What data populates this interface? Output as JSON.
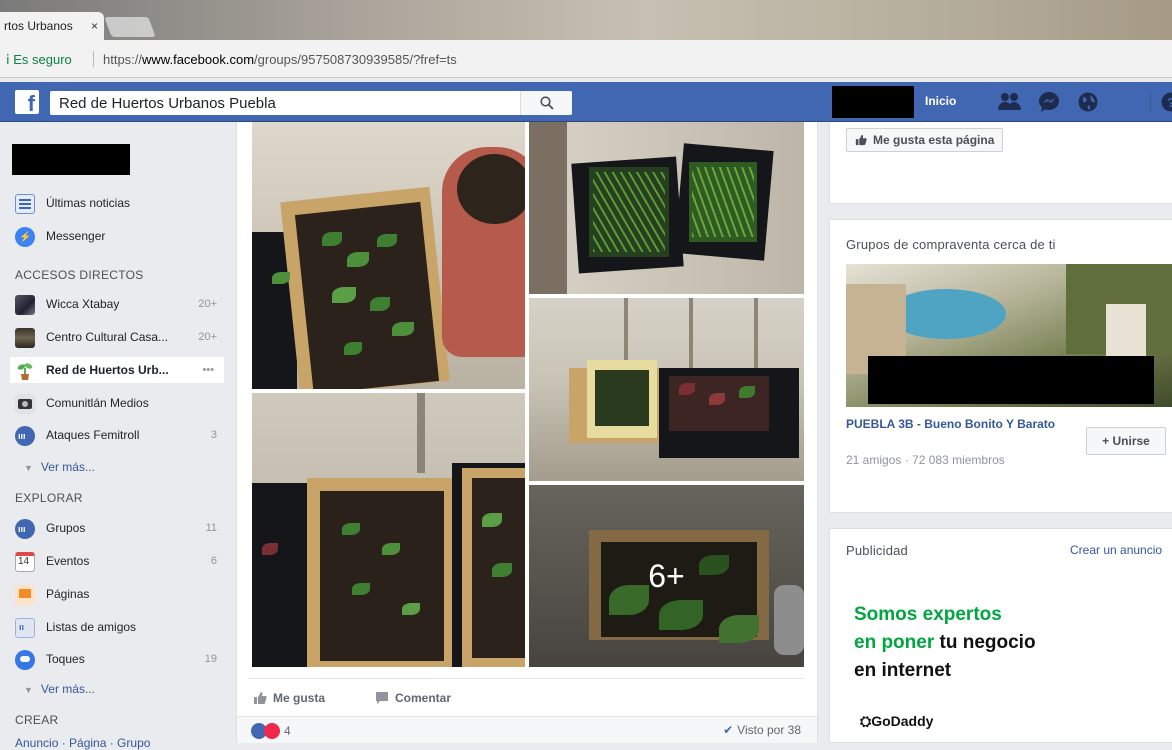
{
  "browser": {
    "tab_title": "rtos Urbanos",
    "tab_close": "×",
    "secure_label": "Es seguro",
    "url_prefix": "https://",
    "url_domain": "www.facebook.com",
    "url_path": "/groups/957508730939585/?fref=ts"
  },
  "header": {
    "logo": "f",
    "search_value": "Red de Huertos Urbanos Puebla",
    "home_label": "Inicio",
    "icons": [
      "search-icon",
      "friend-requests-icon",
      "messenger-icon",
      "notifications-globe-icon",
      "help-icon"
    ]
  },
  "sidebar": {
    "top_items": [
      {
        "label": "Últimas noticias",
        "icon": "news-feed-icon"
      },
      {
        "label": "Messenger",
        "icon": "messenger-icon"
      }
    ],
    "shortcuts_heading": "ACCESOS DIRECTOS",
    "shortcuts": [
      {
        "label": "Wicca Xtabay",
        "count": "20+"
      },
      {
        "label": "Centro Cultural Casa...",
        "count": "20+"
      },
      {
        "label": "Red de Huertos Urb...",
        "count": "•••"
      },
      {
        "label": "Comunitlán Medios",
        "count": ""
      },
      {
        "label": "Ataques Femitroll",
        "count": "3"
      }
    ],
    "see_more": "Ver más...",
    "explore_heading": "EXPLORAR",
    "explore": [
      {
        "label": "Grupos",
        "count": "11"
      },
      {
        "label": "Eventos",
        "count": "6",
        "icon_text": "14"
      },
      {
        "label": "Páginas",
        "count": ""
      },
      {
        "label": "Listas de amigos",
        "count": ""
      },
      {
        "label": "Toques",
        "count": "19"
      }
    ],
    "explore_see_more": "Ver más...",
    "create_heading": "CREAR",
    "create_links": "Anuncio · Página · Grupo"
  },
  "post": {
    "more_photos_label": "6+",
    "like_label": "Me gusta",
    "comment_label": "Comentar",
    "reaction_count": "4",
    "seen_label": "Visto por 38"
  },
  "right": {
    "like_page_label": "Me gusta esta página",
    "groups_title": "Grupos de compraventa cerca de ti",
    "group_name": "PUEBLA 3B - Bueno Bonito Y Barato",
    "group_meta": "21 amigos · 72 083 miembros",
    "join_label": "+ Unirse",
    "ads_title": "Publicidad",
    "ads_create": "Crear un anuncio",
    "ad_line1": "Somos expertos",
    "ad_line2_green": "en poner",
    "ad_line2_dark": " tu negocio",
    "ad_line3": "en internet",
    "ad_brand": "GoDaddy"
  },
  "colors": {
    "facebook_blue": "#4267b2",
    "link_blue": "#365899",
    "ad_green": "#00a63f"
  }
}
